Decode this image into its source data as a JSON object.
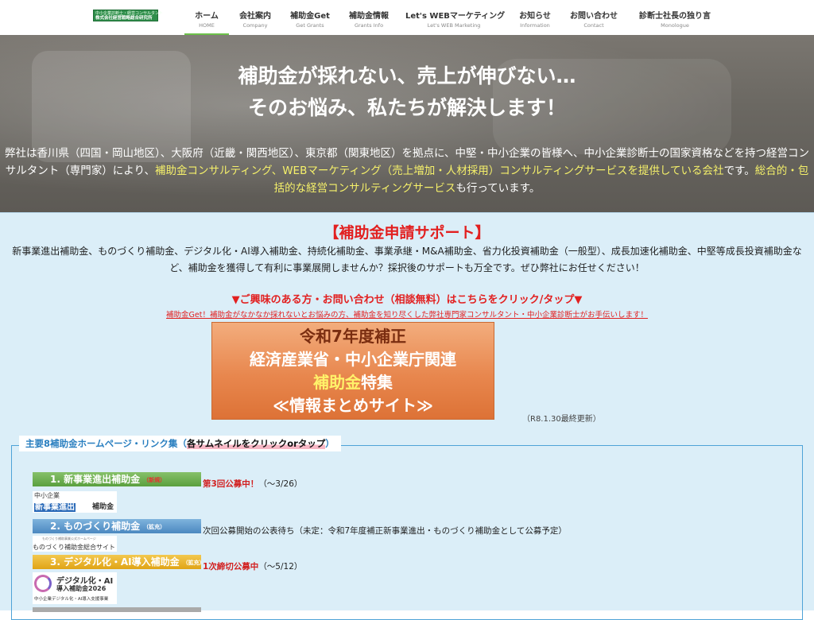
{
  "logo": {
    "line1": "中小企業診断士・経営コンサルタント",
    "line2": "株式会社経営戦略総合研究所"
  },
  "nav": [
    {
      "label": "ホーム",
      "sub": "HOME"
    },
    {
      "label": "会社案内",
      "sub": "Company"
    },
    {
      "label": "補助金Get",
      "sub": "Get Grants"
    },
    {
      "label": "補助金情報",
      "sub": "Grants Info"
    },
    {
      "label": "Let's WEBマーケティング",
      "sub": "Let's WEB Marketing"
    },
    {
      "label": "お知らせ",
      "sub": "Information"
    },
    {
      "label": "お問い合わせ",
      "sub": "Contact"
    },
    {
      "label": "診断士社長の独り言",
      "sub": "Monologue"
    }
  ],
  "hero": {
    "title1": "補助金が採れない、売上が伸びない…",
    "title2": "そのお悩み、私たちが解決します！",
    "p_a": "弊社は香川県（四国・岡山地区）、大阪府（近畿・関西地区）、東京都（関東地区）を拠点に、中堅・中小企業の皆様へ、中小企業診断士の国家資格などを持つ経営コンサルタント（専門家）により、",
    "p_b": "補助金コンサルティング、WEBマーケティング（売上増加・人材採用）コンサルティングサービスを提供している会社",
    "p_c": "です。",
    "p_d": "総合的・包括的な経営コンサルティングサービス",
    "p_e": "も行っています。"
  },
  "support": {
    "title": "【補助金申請サポート】",
    "intro": "新事業進出補助金、ものづくり補助金、デジタル化・AI導入補助金、持続化補助金、事業承継・M&A補助金、省力化投資補助金（一般型）、成長加速化補助金、中堅等成長投資補助金など、補助金を獲得して有利に事業展開しませんか？採択後のサポートも万全です。ぜひ弊社にお任せください！",
    "cta": "▼ご興味のある方・お問い合わせ（相談無料）はこちらをクリック/タップ▼",
    "cta_sub": "補助金Get！補助金がなかなか採れないとお悩みの方、補助金を知り尽くした弊社専門家コンサルタント・中小企業診断士がお手伝いします！"
  },
  "banner": {
    "line1": "令和7年度補正",
    "line2": "経済産業省・中小企業庁関連",
    "line3a": "補助金",
    "line3b": "特集",
    "line4": "≪情報まとめサイト≫",
    "updated": "（R8.1.30最終更新）"
  },
  "links": {
    "title_a": "主要8補助金ホームページ・リンク集（",
    "title_b": "各サムネイルをクリックorタップ",
    "title_c": "）",
    "items": [
      {
        "label": "1. 新事業進出補助金",
        "tag": "（新規）",
        "status_red": "第3回公募中！",
        "status_rest": "（〜3/26）",
        "thumb": [
          "中小企業",
          "新事業進出",
          "補助金"
        ]
      },
      {
        "label": "2. ものづくり補助金",
        "tag": "（拡充）",
        "status_red": "",
        "status_rest": "次回公募開始の公表待ち（未定：令和7年度補正新事業進出・ものづくり補助金として公募予定）",
        "thumb": [
          "ものづくり補助事業公式ホームページ",
          "ものづくり補助金総合サイト"
        ]
      },
      {
        "label": "3. デジタル化・AI導入補助金",
        "tag": "（拡充）",
        "status_red": "1次締切公募中",
        "status_rest": "（〜5/12）",
        "thumb": [
          "デジタル化・AI",
          "導入補助金2026",
          "中小企業デジタル化・AI導入支援事業"
        ]
      }
    ]
  },
  "colors": {
    "accent_red": "#e22020",
    "nav_active": "#6cc04a",
    "section_bg": "#dbeef8",
    "highlight": "#f5f06a"
  }
}
